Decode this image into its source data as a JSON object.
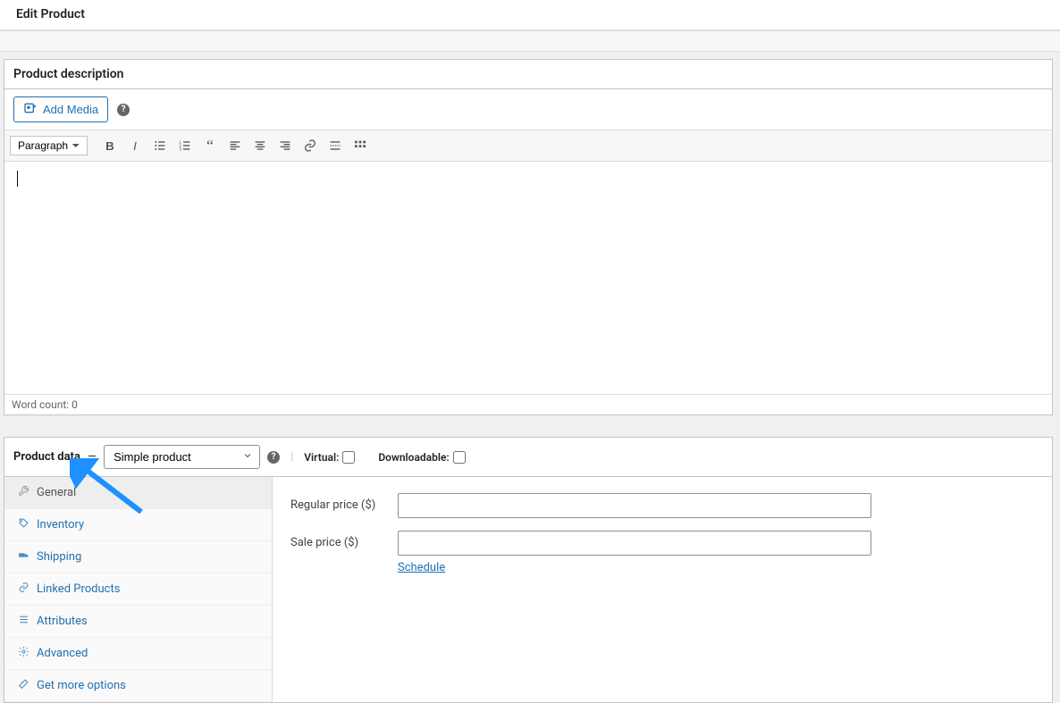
{
  "page": {
    "title": "Edit Product"
  },
  "description_panel": {
    "title": "Product description"
  },
  "media": {
    "add_media_label": "Add Media"
  },
  "toolbar": {
    "format": "Paragraph"
  },
  "editor_footer": {
    "word_count": "Word count: 0"
  },
  "product_data": {
    "title": "Product data",
    "separator": "—",
    "product_type": "Simple product",
    "virtual_label": "Virtual:",
    "downloadable_label": "Downloadable:",
    "tabs": [
      {
        "key": "general",
        "label": "General"
      },
      {
        "key": "inventory",
        "label": "Inventory"
      },
      {
        "key": "shipping",
        "label": "Shipping"
      },
      {
        "key": "linked",
        "label": "Linked Products"
      },
      {
        "key": "attributes",
        "label": "Attributes"
      },
      {
        "key": "advanced",
        "label": "Advanced"
      },
      {
        "key": "more",
        "label": "Get more options"
      }
    ],
    "fields": {
      "regular_price_label": "Regular price ($)",
      "sale_price_label": "Sale price ($)",
      "schedule_label": "Schedule"
    }
  }
}
